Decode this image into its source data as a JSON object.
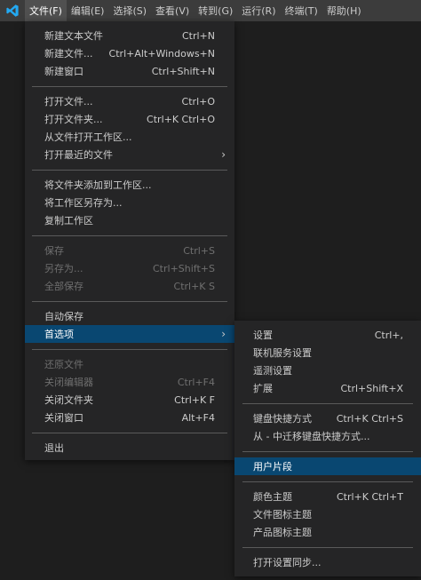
{
  "menubar": {
    "items": [
      "文件(F)",
      "编辑(E)",
      "选择(S)",
      "查看(V)",
      "转到(G)",
      "运行(R)",
      "终端(T)",
      "帮助(H)"
    ],
    "active_index": 0
  },
  "file_menu": {
    "new_text_file": {
      "label": "新建文本文件",
      "shortcut": "Ctrl+N"
    },
    "new_file": {
      "label": "新建文件...",
      "shortcut": "Ctrl+Alt+Windows+N"
    },
    "new_window": {
      "label": "新建窗口",
      "shortcut": "Ctrl+Shift+N"
    },
    "open_file": {
      "label": "打开文件...",
      "shortcut": "Ctrl+O"
    },
    "open_folder": {
      "label": "打开文件夹...",
      "shortcut": "Ctrl+K Ctrl+O"
    },
    "open_workspace": {
      "label": "从文件打开工作区..."
    },
    "open_recent": {
      "label": "打开最近的文件",
      "arrow": "›"
    },
    "add_folder": {
      "label": "将文件夹添加到工作区..."
    },
    "save_workspace_as": {
      "label": "将工作区另存为..."
    },
    "duplicate_workspace": {
      "label": "复制工作区"
    },
    "save": {
      "label": "保存",
      "shortcut": "Ctrl+S"
    },
    "save_as": {
      "label": "另存为...",
      "shortcut": "Ctrl+Shift+S"
    },
    "save_all": {
      "label": "全部保存",
      "shortcut": "Ctrl+K S"
    },
    "auto_save": {
      "label": "自动保存"
    },
    "preferences": {
      "label": "首选项",
      "arrow": "›"
    },
    "revert_file": {
      "label": "还原文件"
    },
    "close_editor": {
      "label": "关闭编辑器",
      "shortcut": "Ctrl+F4"
    },
    "close_folder": {
      "label": "关闭文件夹",
      "shortcut": "Ctrl+K F"
    },
    "close_window": {
      "label": "关闭窗口",
      "shortcut": "Alt+F4"
    },
    "exit": {
      "label": "退出"
    }
  },
  "pref_menu": {
    "settings": {
      "label": "设置",
      "shortcut": "Ctrl+,"
    },
    "online_services": {
      "label": "联机服务设置"
    },
    "telemetry": {
      "label": "遥测设置"
    },
    "extensions": {
      "label": "扩展",
      "shortcut": "Ctrl+Shift+X"
    },
    "keyboard_shortcuts": {
      "label": "键盘快捷方式",
      "shortcut": "Ctrl+K Ctrl+S"
    },
    "migrate_keymaps": {
      "label": "从 - 中迁移键盘快捷方式..."
    },
    "user_snippets": {
      "label": "用户片段"
    },
    "color_theme": {
      "label": "颜色主题",
      "shortcut": "Ctrl+K Ctrl+T"
    },
    "file_icon_theme": {
      "label": "文件图标主题"
    },
    "product_icon_theme": {
      "label": "产品图标主题"
    },
    "settings_sync": {
      "label": "打开设置同步..."
    }
  },
  "colors": {
    "titlebar": "#3c3c3c",
    "menu_bg": "#252526",
    "highlight": "#094771",
    "logo": "#23a9f2"
  },
  "icons": {
    "app_logo": "vscode-logo-icon",
    "submenu": "chevron-right-icon"
  }
}
